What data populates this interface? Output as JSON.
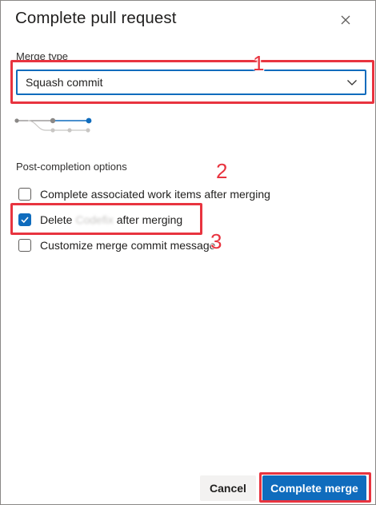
{
  "dialog": {
    "title": "Complete pull request",
    "close_icon": "close-icon"
  },
  "merge_type": {
    "label": "Merge type",
    "selected": "Squash commit",
    "chevron_icon": "chevron-down-icon"
  },
  "post_completion": {
    "label": "Post-completion options",
    "options": [
      {
        "label": "Complete associated work items after merging",
        "checked": false
      },
      {
        "label_prefix": "Delete ",
        "label_blurred": "Codefix",
        "label_suffix": " after merging",
        "checked": true
      },
      {
        "label": "Customize merge commit message",
        "checked": false
      }
    ]
  },
  "annotations": [
    "1",
    "2",
    "3"
  ],
  "footer": {
    "cancel_label": "Cancel",
    "complete_label": "Complete merge"
  },
  "colors": {
    "accent": "#0f6cbd",
    "annotation": "#e8343f"
  }
}
